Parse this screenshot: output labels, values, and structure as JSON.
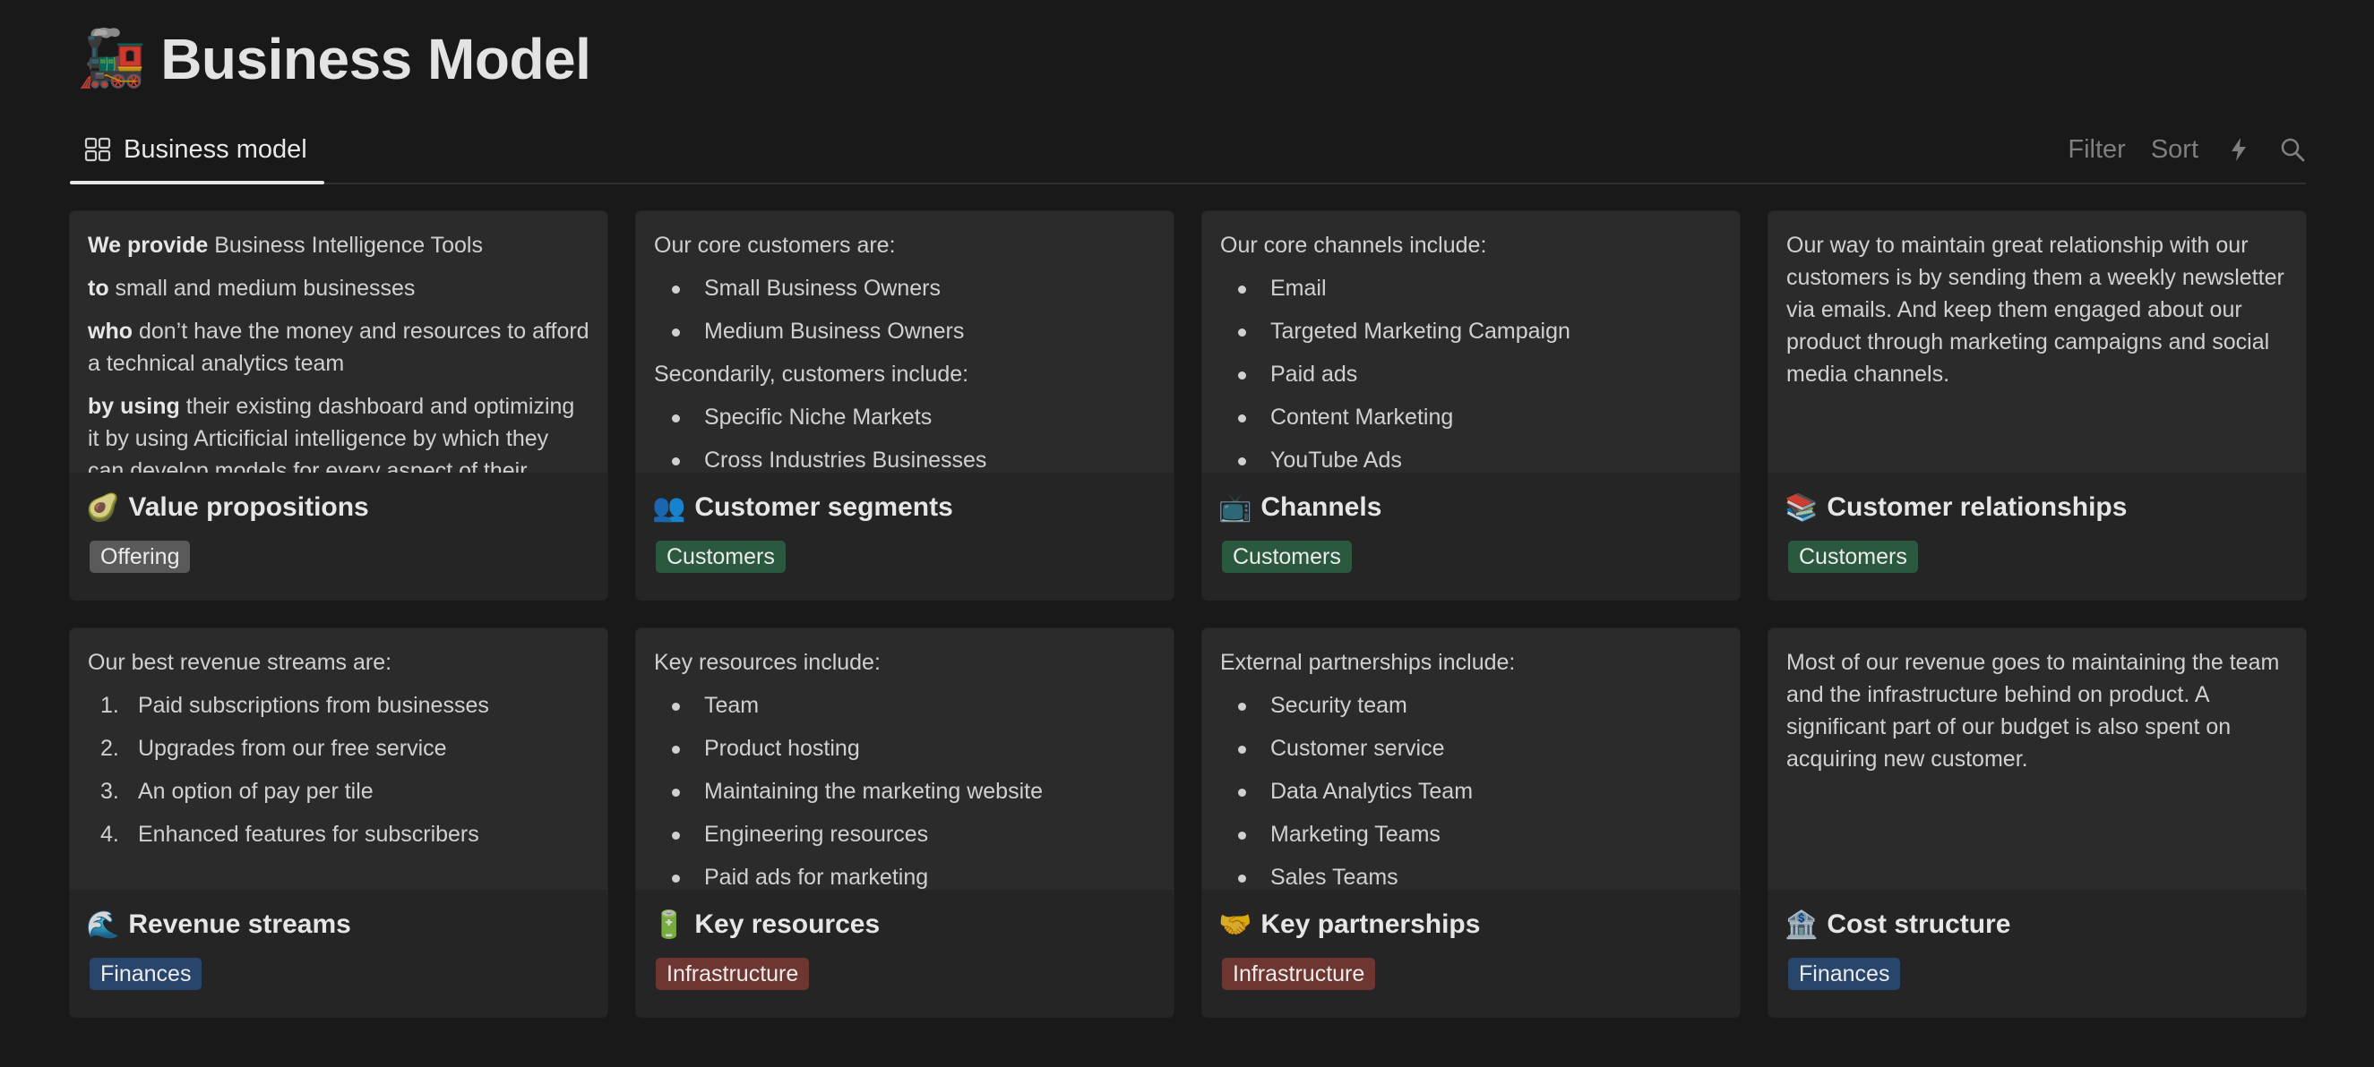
{
  "page": {
    "title_icon": "🚂",
    "title": "Business Model"
  },
  "view": {
    "tab_label": "Business model",
    "tools": {
      "filter": "Filter",
      "sort": "Sort"
    }
  },
  "colors": {
    "tag_offering": "#5a5a5a",
    "tag_customers": "#2b593f",
    "tag_finances": "#28456c",
    "tag_infrastructure": "#6e3630"
  },
  "cards": [
    {
      "emoji": "🥑",
      "title": "Value propositions",
      "tag": "Offering",
      "paragraphs": [
        {
          "bold": "We provide",
          "text": " Business Intelligence Tools"
        },
        {
          "bold": "to",
          "text": " small and medium businesses"
        },
        {
          "bold": "who",
          "text": " don’t have the money and resources to afford a technical analytics team"
        },
        {
          "bold": "by using",
          "text": " their existing dashboard and optimizing it by using Articificial intelligence by which they can develop models for every aspect of their"
        }
      ]
    },
    {
      "emoji": "👥",
      "title": "Customer segments",
      "tag": "Customers",
      "intro1": "Our core customers are:",
      "list1": [
        "Small Business Owners",
        "Medium Business Owners"
      ],
      "intro2": "Secondarily, customers include:",
      "list2": [
        "Specific Niche Markets",
        "Cross Industries Businesses"
      ]
    },
    {
      "emoji": "📺",
      "title": "Channels",
      "tag": "Customers",
      "intro": "Our core channels include:",
      "list": [
        "Email",
        "Targeted Marketing Campaign",
        "Paid ads",
        "Content Marketing",
        "YouTube Ads"
      ]
    },
    {
      "emoji": "📚",
      "title": "Customer relationships",
      "tag": "Customers",
      "text": "Our way to maintain great relationship with our customers is by sending them a weekly newsletter via emails. And keep them engaged about our product through marketing campaigns and social media channels."
    },
    {
      "emoji": "🌊",
      "title": "Revenue streams",
      "tag": "Finances",
      "intro": "Our best revenue streams are:",
      "list": [
        {
          "num": "1.",
          "text": "Paid subscriptions from businesses"
        },
        {
          "num": "2.",
          "text": "Upgrades from our free service"
        },
        {
          "num": "3.",
          "text": "An option of pay per tile"
        },
        {
          "num": "4.",
          "text": "Enhanced features for subscribers"
        }
      ]
    },
    {
      "emoji": "🔋",
      "title": "Key resources",
      "tag": "Infrastructure",
      "intro": "Key resources include:",
      "list": [
        "Team",
        "Product hosting",
        "Maintaining the marketing website",
        "Engineering resources",
        "Paid ads for marketing"
      ]
    },
    {
      "emoji": "🤝",
      "title": "Key partnerships",
      "tag": "Infrastructure",
      "intro": "External partnerships include:",
      "list": [
        "Security team",
        "Customer service",
        "Data Analytics Team",
        "Marketing Teams",
        "Sales Teams"
      ]
    },
    {
      "emoji": "🏦",
      "title": "Cost structure",
      "tag": "Finances",
      "text": "Most of our revenue goes to maintaining the team and the infrastructure behind on product. A significant part of our budget is also spent on acquiring new customer."
    }
  ]
}
